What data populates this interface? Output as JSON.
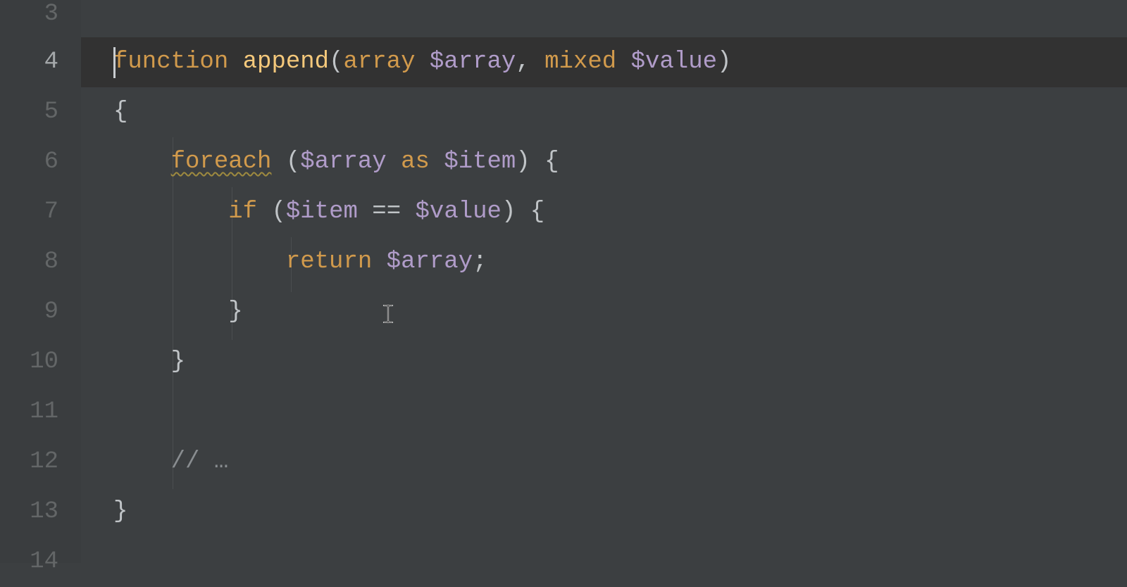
{
  "gutter": {
    "start": 3,
    "lines": [
      "3",
      "4",
      "5",
      "6",
      "7",
      "8",
      "9",
      "10",
      "11",
      "12",
      "13",
      "14"
    ],
    "active_index": 1
  },
  "code": {
    "line3": "",
    "line4": {
      "kw_function": "function",
      "fn_name": "append",
      "paren_open": "(",
      "type_array": "array",
      "var_array": "$array",
      "comma": ",",
      "type_mixed": "mixed",
      "var_value": "$value",
      "paren_close": ")"
    },
    "line5": {
      "brace": "{"
    },
    "line6": {
      "indent": "    ",
      "kw_foreach": "foreach",
      "paren_open": " (",
      "var_array": "$array",
      "kw_as": " as ",
      "var_item": "$item",
      "paren_close_brace": ") {"
    },
    "line7": {
      "indent": "        ",
      "kw_if": "if",
      "paren_open": " (",
      "var_item": "$item",
      "op_eq": " == ",
      "var_value": "$value",
      "paren_close_brace": ") {"
    },
    "line8": {
      "indent": "            ",
      "kw_return": "return",
      "sp": " ",
      "var_array": "$array",
      "semi": ";"
    },
    "line9": {
      "indent": "        ",
      "brace": "}"
    },
    "line10": {
      "indent": "    ",
      "brace": "}"
    },
    "line11": "",
    "line12": {
      "indent": "    ",
      "comment": "// …"
    },
    "line13": {
      "brace": "}"
    },
    "line14": ""
  },
  "colors": {
    "background": "#3c3f41",
    "gutter_bg": "#3a3d3f",
    "highlight_bg": "#323232",
    "keyword": "#d19a4c",
    "function_name": "#f4c87b",
    "variable": "#b09cc9",
    "punctuation": "#c0c4c7",
    "comment": "#898d90"
  },
  "cursor": {
    "line": 4,
    "col": 0
  },
  "text_cursor_pos": {
    "line": 9,
    "approx_col": 18
  }
}
